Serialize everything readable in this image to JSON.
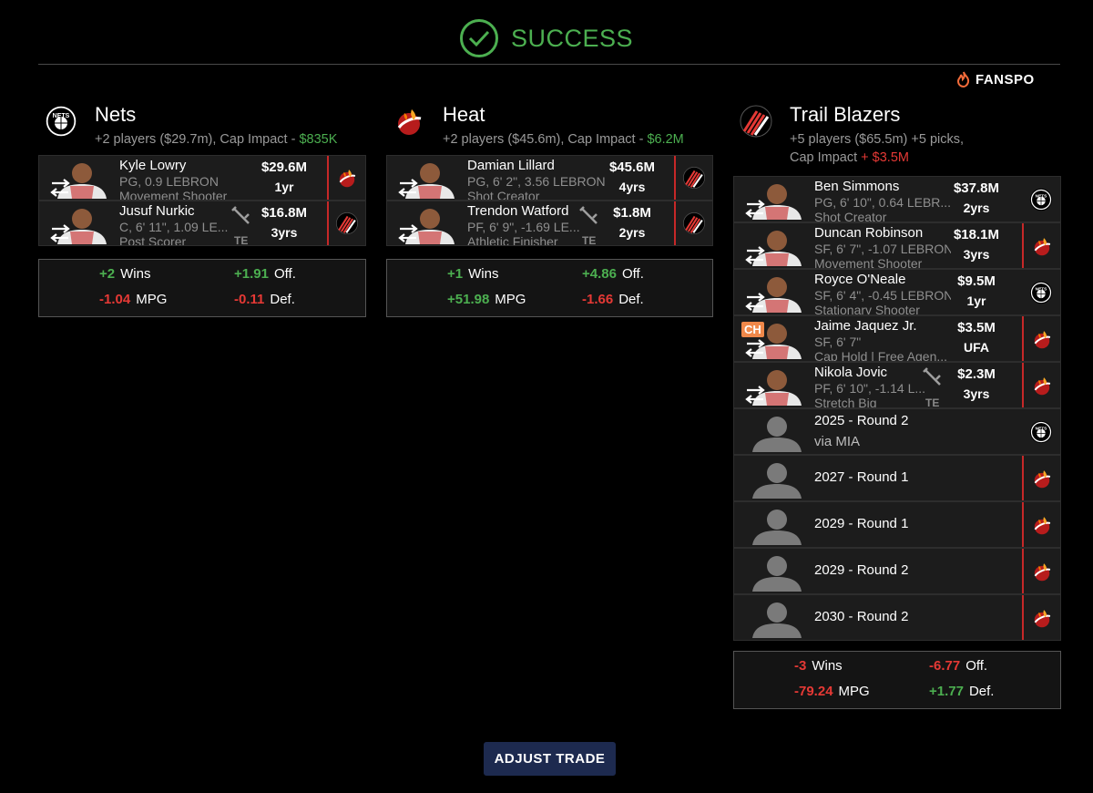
{
  "status": "SUCCESS",
  "brand": "FANSPO",
  "adjust_button": "ADJUST TRADE",
  "icons": {
    "success": "check-circle-icon",
    "brand": "flame-icon",
    "swap": "swap-arrows-icon",
    "trade_flag": "wrench-icon"
  },
  "colors": {
    "success": "#4caf50",
    "negative": "#e53935",
    "button": "#1d2a4f",
    "heat_border": "#c62828"
  },
  "teams": [
    {
      "name": "Nets",
      "summary": "+2 players ($29.7m), Cap Impact - ",
      "summary_line2": "",
      "cap_impact": "$835K",
      "cap_sign": "",
      "players": [
        {
          "name": "Kyle Lowry",
          "detail1": "PG, 0.9 LEBRON",
          "detail2": "Movement Shooter",
          "salary": "$29.6M",
          "years": "1yr",
          "from": "Heat",
          "flag": ""
        },
        {
          "name": "Jusuf Nurkic",
          "detail1": "C, 6' 11\", 1.09 LE...",
          "detail2": "Post Scorer",
          "salary": "$16.8M",
          "years": "3yrs",
          "from": "Trail Blazers",
          "flag": "TE"
        }
      ],
      "stats": {
        "wins": "+2",
        "wins_label": "Wins",
        "off": "+1.91",
        "off_label": "Off.",
        "mpg": "-1.04",
        "mpg_label": "MPG",
        "def": "-0.11",
        "def_label": "Def."
      }
    },
    {
      "name": "Heat",
      "summary": "+2 players ($45.6m), Cap Impact - ",
      "summary_line2": "",
      "cap_impact": "$6.2M",
      "cap_sign": "",
      "players": [
        {
          "name": "Damian Lillard",
          "detail1": "PG, 6' 2\", 3.56 LEBRON",
          "detail2": "Shot Creator",
          "salary": "$45.6M",
          "years": "4yrs",
          "from": "Trail Blazers",
          "flag": ""
        },
        {
          "name": "Trendon Watford",
          "detail1": "PF, 6' 9\", -1.69 LE...",
          "detail2": "Athletic Finisher",
          "salary": "$1.8M",
          "years": "2yrs",
          "from": "Trail Blazers",
          "flag": "TE"
        }
      ],
      "stats": {
        "wins": "+1",
        "wins_label": "Wins",
        "off": "+4.86",
        "off_label": "Off.",
        "mpg": "+51.98",
        "mpg_label": "MPG",
        "def": "-1.66",
        "def_label": "Def."
      }
    },
    {
      "name": "Trail Blazers",
      "summary": "+5 players ($65.5m) +5 picks,",
      "summary_line2": "Cap Impact ",
      "cap_impact": "$3.5M",
      "cap_sign": "+ ",
      "players": [
        {
          "name": "Ben Simmons",
          "detail1": "PG, 6' 10\", 0.64 LEBR...",
          "detail2": "Shot Creator",
          "salary": "$37.8M",
          "years": "2yrs",
          "from": "Nets",
          "flag": ""
        },
        {
          "name": "Duncan Robinson",
          "detail1": "SF, 6' 7\", -1.07 LEBRON",
          "detail2": "Movement Shooter",
          "salary": "$18.1M",
          "years": "3yrs",
          "from": "Heat",
          "flag": ""
        },
        {
          "name": "Royce O'Neale",
          "detail1": "SF, 6' 4\", -0.45 LEBRON",
          "detail2": "Stationary Shooter",
          "salary": "$9.5M",
          "years": "1yr",
          "from": "Nets",
          "flag": ""
        },
        {
          "name": "Jaime Jaquez Jr.",
          "detail1": "SF, 6' 7\"",
          "detail2": "Cap Hold | Free Agen...",
          "salary": "$3.5M",
          "years": "UFA",
          "from": "Heat",
          "flag": "",
          "badge": "CH"
        },
        {
          "name": "Nikola Jovic",
          "detail1": "PF, 6' 10\", -1.14 L...",
          "detail2": "Stretch Big",
          "salary": "$2.3M",
          "years": "3yrs",
          "from": "Heat",
          "flag": "TE"
        }
      ],
      "picks": [
        {
          "label": "2025 - Round 2",
          "via": "via MIA",
          "from": "Nets"
        },
        {
          "label": "2027 - Round 1",
          "via": "",
          "from": "Heat"
        },
        {
          "label": "2029 - Round 1",
          "via": "",
          "from": "Heat"
        },
        {
          "label": "2029 - Round 2",
          "via": "",
          "from": "Heat"
        },
        {
          "label": "2030 - Round 2",
          "via": "",
          "from": "Heat"
        }
      ],
      "stats": {
        "wins": "-3",
        "wins_label": "Wins",
        "off": "-6.77",
        "off_label": "Off.",
        "mpg": "-79.24",
        "mpg_label": "MPG",
        "def": "+1.77",
        "def_label": "Def."
      }
    }
  ]
}
